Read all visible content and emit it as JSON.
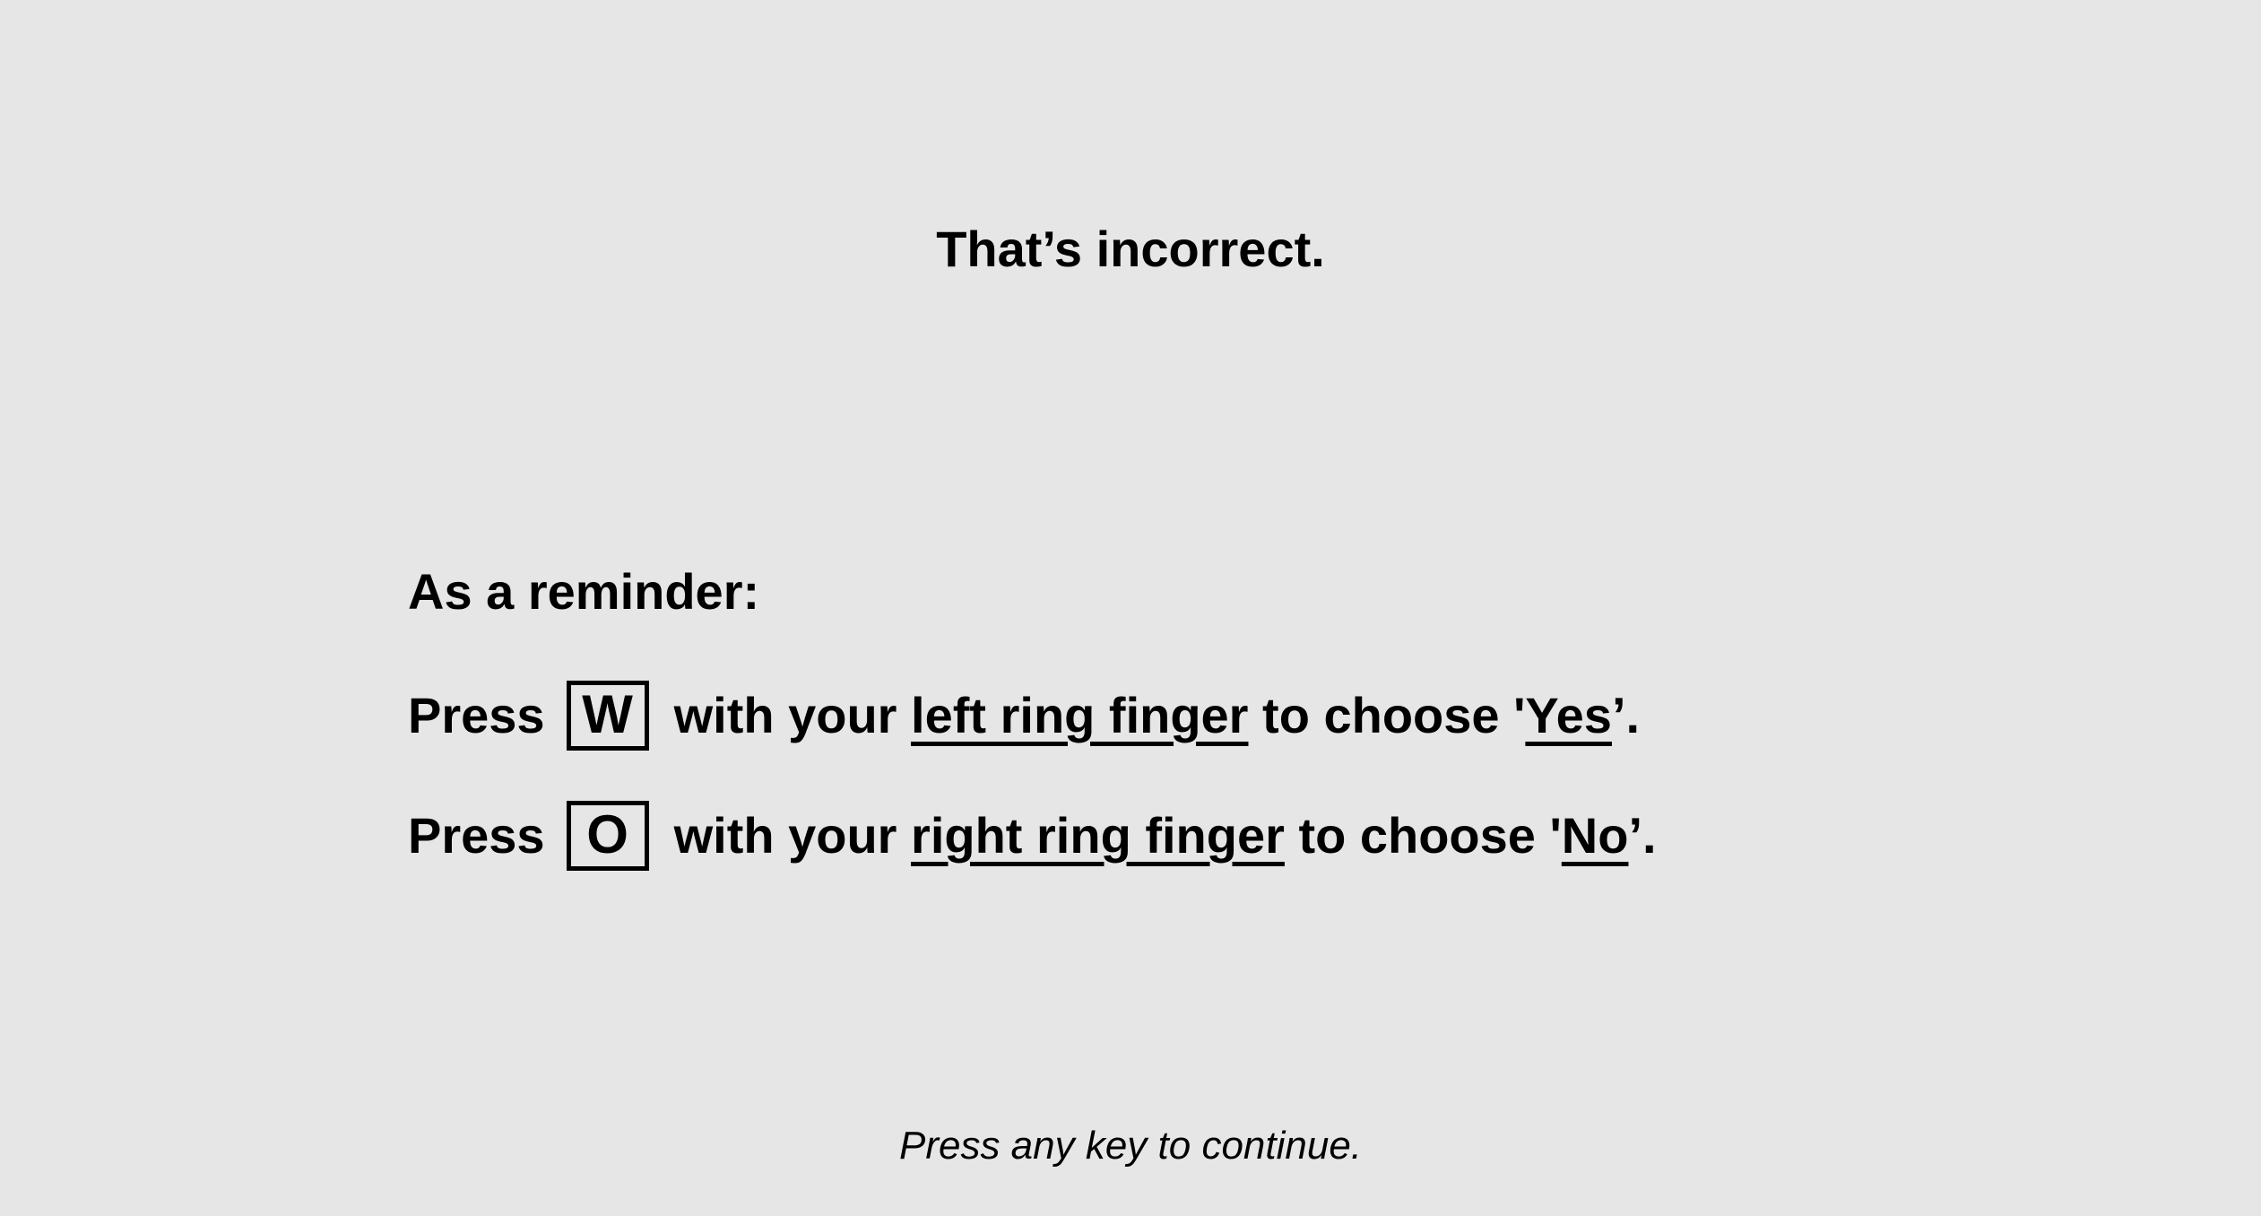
{
  "feedback": {
    "text": "That’s incorrect."
  },
  "reminder": {
    "heading": "As a reminder:",
    "lines": [
      {
        "press": "Press",
        "key": "W",
        "with_your": "with your",
        "finger": "left ring finger",
        "to_choose": "to choose '",
        "choice": "Yes",
        "end": "’."
      },
      {
        "press": "Press",
        "key": "O",
        "with_your": "with your",
        "finger": "right ring finger",
        "to_choose": "to choose '",
        "choice": "No",
        "end": "’."
      }
    ]
  },
  "continue_prompt": "Press any key to continue.",
  "colors": {
    "background": "#e6e6e6",
    "text": "#000000"
  }
}
